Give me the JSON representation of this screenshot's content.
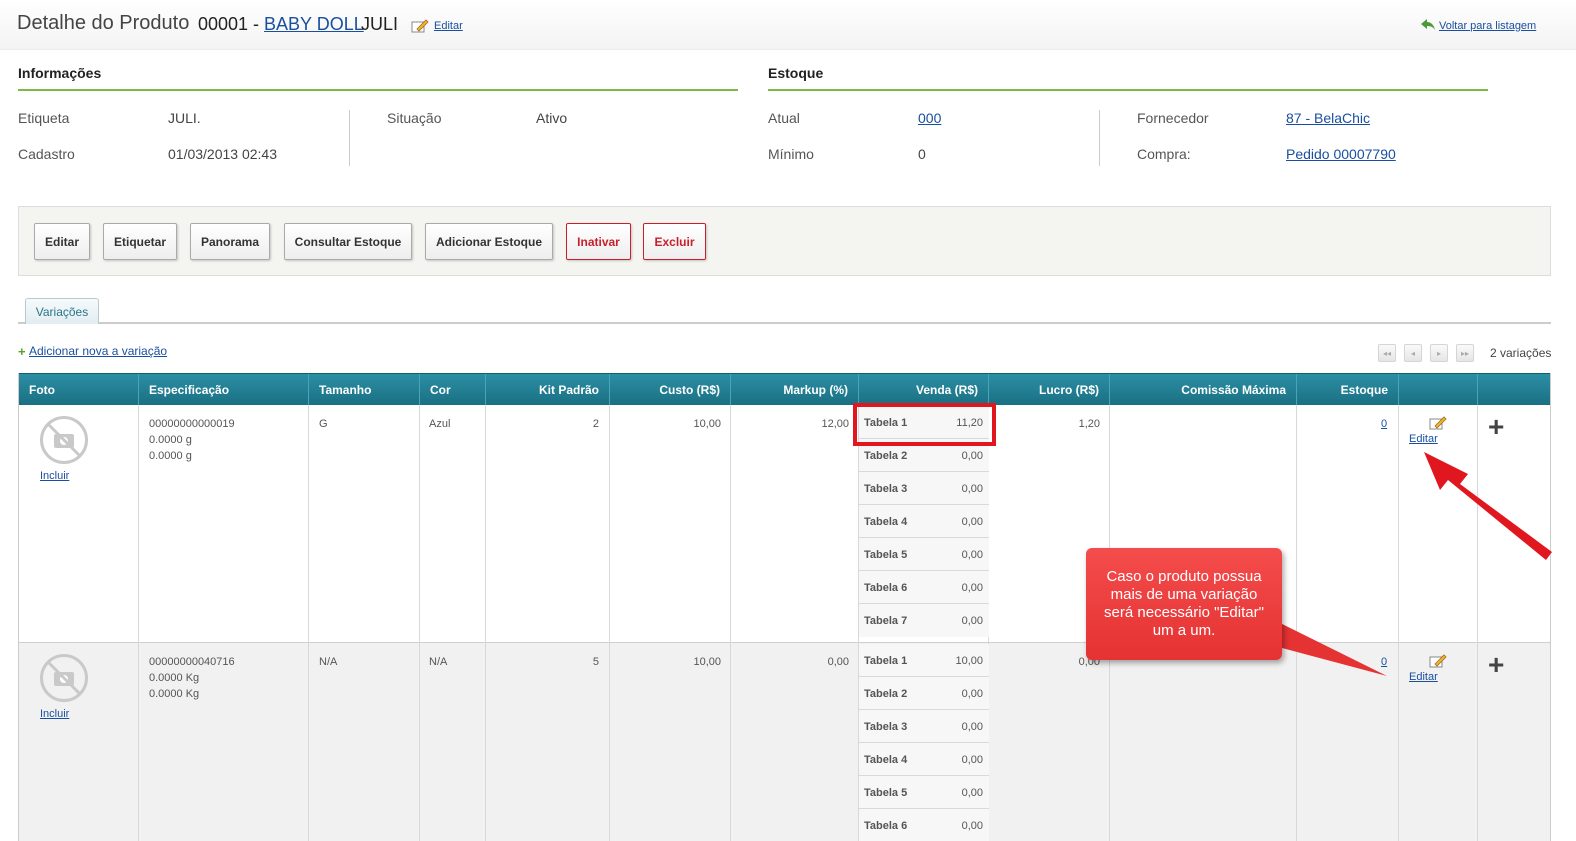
{
  "header": {
    "title": "Detalhe do Produto",
    "code": "00001 -",
    "name_link": "BABY DOLL",
    "name_rest": "JULI",
    "edit_label": "Editar",
    "back_label": "Voltar para listagem"
  },
  "info": {
    "title": "Informações",
    "etiqueta_label": "Etiqueta",
    "etiqueta_value": "JULI.",
    "cadastro_label": "Cadastro",
    "cadastro_value": "01/03/2013 02:43",
    "situacao_label": "Situação",
    "situacao_value": "Ativo"
  },
  "stock": {
    "title": "Estoque",
    "atual_label": "Atual",
    "atual_value": "000",
    "minimo_label": "Mínimo",
    "minimo_value": "0",
    "fornecedor_label": "Fornecedor",
    "fornecedor_value": "87 - BelaChic",
    "compra_label": "Compra:",
    "compra_value": "Pedido 00007790"
  },
  "actions": [
    "Editar",
    "Etiquetar",
    "Panorama",
    "Consultar Estoque",
    "Adicionar Estoque",
    "Inativar",
    "Excluir"
  ],
  "tabs": {
    "variacoes": "Variações"
  },
  "add_variation": "Adicionar nova a variação",
  "pager": {
    "first": "◂◂",
    "prev": "◂",
    "next": "▸",
    "last": "▸▸",
    "count": "2 variações"
  },
  "table": {
    "headers": [
      "Foto",
      "Especificação",
      "Tamanho",
      "Cor",
      "Kit Padrão",
      "Custo (R$)",
      "Markup (%)",
      "Venda (R$)",
      "Lucro (R$)",
      "Comissão Máxima",
      "Estoque"
    ],
    "rows": [
      {
        "photo_link": "Incluir",
        "spec": [
          "00000000000019",
          "0.0000 g",
          "0.0000 g"
        ],
        "tamanho": "G",
        "cor": "Azul",
        "kit": "2",
        "custo": "10,00",
        "markup": "12,00",
        "prices": [
          {
            "name": "Tabela 1",
            "value": "11,20"
          },
          {
            "name": "Tabela 2",
            "value": "0,00"
          },
          {
            "name": "Tabela 3",
            "value": "0,00"
          },
          {
            "name": "Tabela 4",
            "value": "0,00"
          },
          {
            "name": "Tabela 5",
            "value": "0,00"
          },
          {
            "name": "Tabela 6",
            "value": "0,00"
          },
          {
            "name": "Tabela 7",
            "value": "0,00"
          }
        ],
        "lucro": "1,20",
        "estoque": "0",
        "edit": "Editar"
      },
      {
        "photo_link": "Incluir",
        "spec": [
          "00000000040716",
          "0.0000 Kg",
          "0.0000 Kg"
        ],
        "tamanho": "N/A",
        "cor": "N/A",
        "kit": "5",
        "custo": "10,00",
        "markup": "0,00",
        "prices": [
          {
            "name": "Tabela 1",
            "value": "10,00"
          },
          {
            "name": "Tabela 2",
            "value": "0,00"
          },
          {
            "name": "Tabela 3",
            "value": "0,00"
          },
          {
            "name": "Tabela 4",
            "value": "0,00"
          },
          {
            "name": "Tabela 5",
            "value": "0,00"
          },
          {
            "name": "Tabela 6",
            "value": "0,00"
          }
        ],
        "lucro": "0,00",
        "estoque": "0",
        "edit": "Editar"
      }
    ]
  },
  "callout": "Caso o produto possua mais de uma variação será necessário \"Editar\" um a um.",
  "colors": {
    "accent_green": "#7cba43",
    "header_teal": "#1a6f83",
    "link_blue": "#1a4fa0",
    "danger_red": "#c8202a",
    "callout_red": "#e53232"
  }
}
